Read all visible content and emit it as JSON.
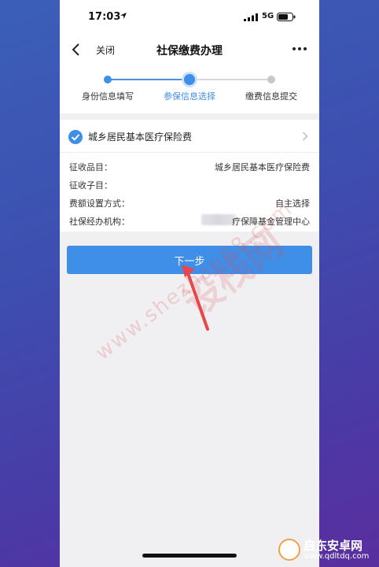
{
  "status_bar": {
    "time": "17:03",
    "network": "5G"
  },
  "nav": {
    "close_label": "关闭",
    "title": "社保缴费办理"
  },
  "steps": [
    {
      "label": "身份信息填写",
      "state": "done"
    },
    {
      "label": "参保信息选择",
      "state": "current"
    },
    {
      "label": "缴费信息提交",
      "state": "pending"
    }
  ],
  "card": {
    "title": "城乡居民基本医疗保险费",
    "rows": [
      {
        "label": "征收品目：",
        "value": "城乡居民基本医疗保险费"
      },
      {
        "label": "征收子目：",
        "value": ""
      },
      {
        "label": "费额设置方式：",
        "value": "自主选择"
      },
      {
        "label": "社保经办机构：",
        "value": "疗保障基金管理中心"
      }
    ]
  },
  "next_button_label": "下一步",
  "watermark": {
    "line1": "设栈网",
    "line2": "www.shezhan88.com"
  },
  "site_logo": {
    "name": "启东安卓网",
    "url": "www.qdltdq.com"
  },
  "colors": {
    "accent": "#3f8ee8",
    "arrow": "#e8464a"
  },
  "icons": {
    "location": "location-arrow-icon",
    "signal": "signal-bars-icon",
    "battery": "battery-icon",
    "back": "back-chevron-icon",
    "more": "more-dots-icon",
    "check": "check-circle-icon",
    "chevron": "chevron-right-icon"
  }
}
